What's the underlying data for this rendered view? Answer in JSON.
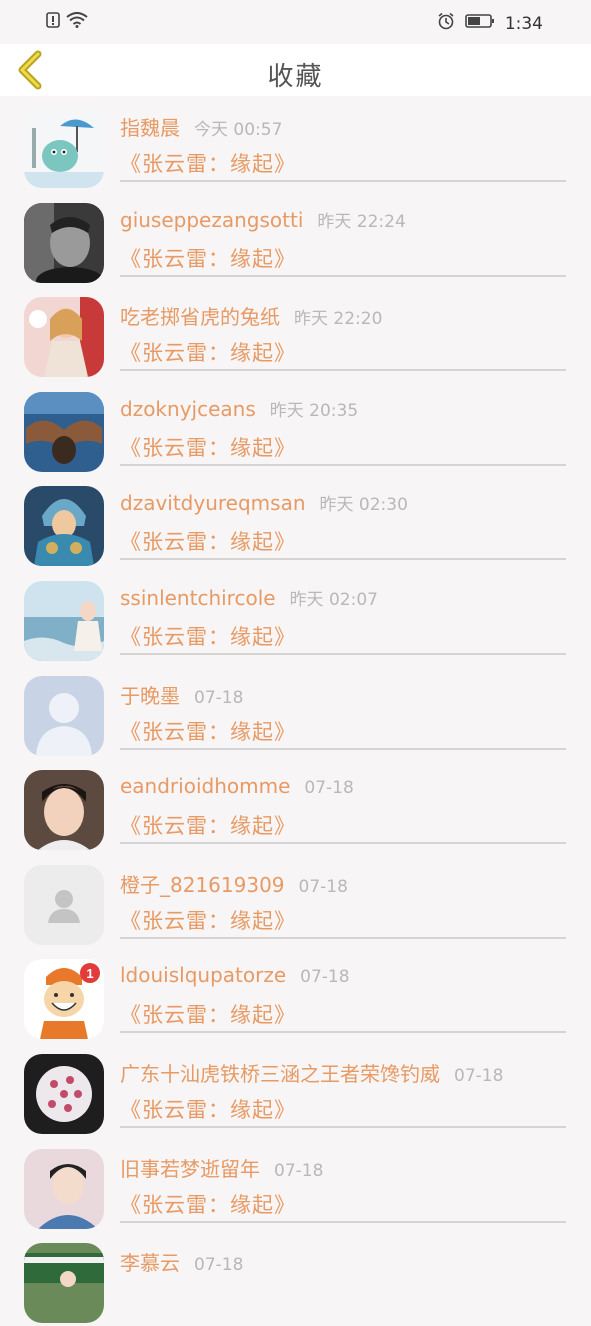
{
  "status_bar": {
    "time": "1:34",
    "icons": [
      "alert-icon",
      "wifi-icon",
      "alarm-icon",
      "battery-icon"
    ]
  },
  "header": {
    "title": "收藏",
    "back_icon": "chevron-left-icon"
  },
  "colors": {
    "accent": "#e79a64",
    "time_text": "#b9b7b7",
    "back_arrow": "#c8b62a"
  },
  "favorites": [
    {
      "user": "指魏晨",
      "time": "今天 00:57",
      "book": "《张云雷：缘起》"
    },
    {
      "user": "giuseppezangsotti",
      "time": "昨天 22:24",
      "book": "《张云雷：缘起》"
    },
    {
      "user": "吃老掷省虎的兔纸",
      "time": "昨天 22:20",
      "book": "《张云雷：缘起》"
    },
    {
      "user": "dzoknyjceans",
      "time": "昨天 20:35",
      "book": "《张云雷：缘起》"
    },
    {
      "user": "dzavitdyureqmsan",
      "time": "昨天 02:30",
      "book": "《张云雷：缘起》"
    },
    {
      "user": "ssinlentchircole",
      "time": "昨天 02:07",
      "book": "《张云雷：缘起》"
    },
    {
      "user": "于晚墨",
      "time": "07-18",
      "book": "《张云雷：缘起》"
    },
    {
      "user": "eandrioidhomme",
      "time": "07-18",
      "book": "《张云雷：缘起》"
    },
    {
      "user": "橙子_821619309",
      "time": "07-18",
      "book": "《张云雷：缘起》"
    },
    {
      "user": "ldouislqupatorze",
      "time": "07-18",
      "book": "《张云雷：缘起》",
      "badge": "1"
    },
    {
      "user": "广东十汕虎铁桥三涵之王者荣馋钓威",
      "time": "07-18",
      "book": "《张云雷：缘起》"
    },
    {
      "user": "旧事若梦逝留年",
      "time": "07-18",
      "book": "《张云雷：缘起》"
    },
    {
      "user": "李慕云",
      "time": "07-18",
      "book": ""
    }
  ]
}
